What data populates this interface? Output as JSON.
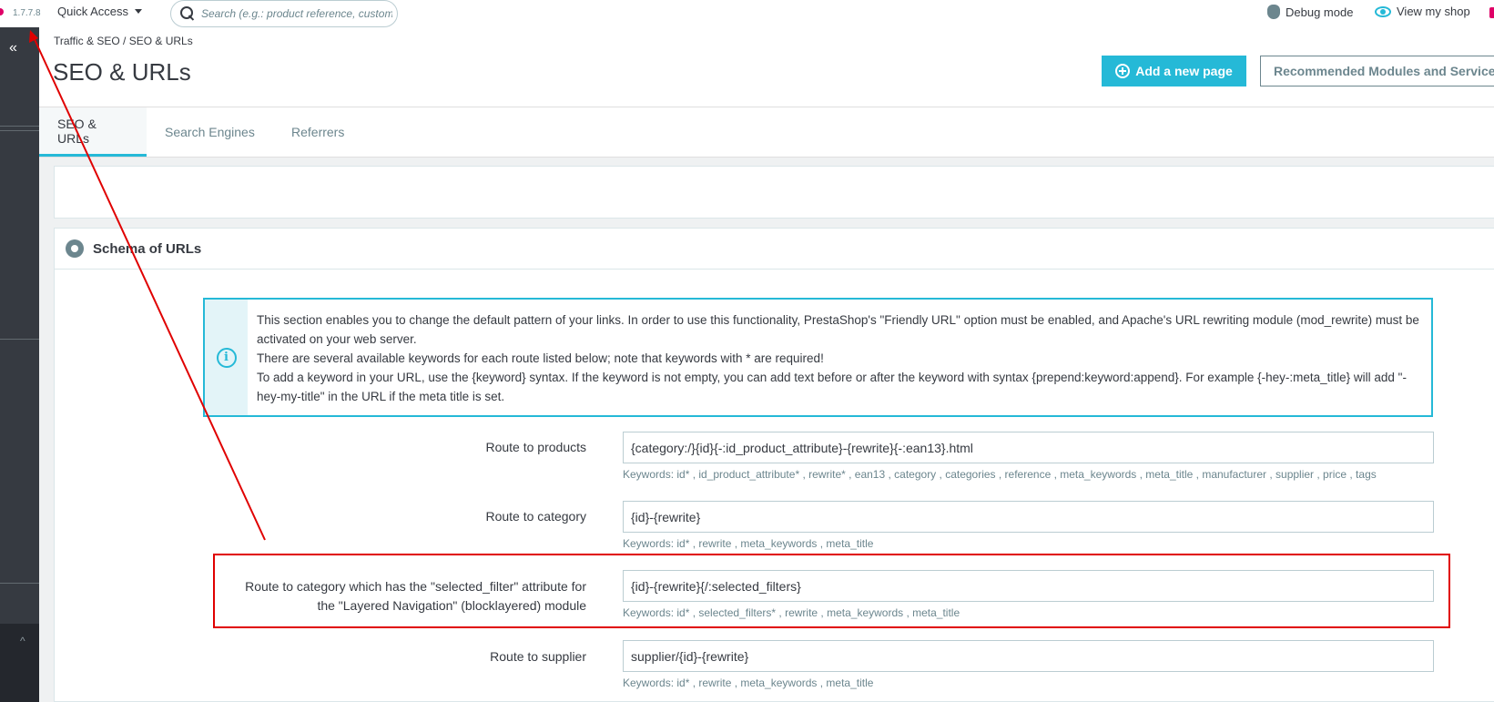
{
  "header": {
    "version": "1.7.7.8",
    "quick_access": "Quick Access",
    "search_placeholder": "Search (e.g.: product reference, custome",
    "debug_mode": "Debug mode",
    "view_shop": "View my shop"
  },
  "sidebar": {
    "collapse_glyph": "«",
    "scroll_up_glyph": "^"
  },
  "page": {
    "breadcrumb": "Traffic & SEO  /  SEO & URLs",
    "title": "SEO & URLs",
    "add_page_button": "Add a new page",
    "recommended_button": "Recommended Modules and Services"
  },
  "tabs": [
    {
      "label": "SEO & URLs",
      "active": true
    },
    {
      "label": "Search Engines",
      "active": false
    },
    {
      "label": "Referrers",
      "active": false
    }
  ],
  "schema_panel": {
    "title": "Schema of URLs",
    "info_glyph": "i",
    "alert_lines": [
      "This section enables you to change the default pattern of your links. In order to use this functionality, PrestaShop's \"Friendly URL\" option must be enabled, and Apache's URL rewriting module (mod_rewrite) must be activated on your web server.",
      "There are several available keywords for each route listed below; note that keywords with * are required!",
      "To add a keyword in your URL, use the {keyword} syntax. If the keyword is not empty, you can add text before or after the keyword with syntax {prepend:keyword:append}. For example {-hey-:meta_title} will add \"-hey-my-title\" in the URL if the meta title is set."
    ],
    "routes": [
      {
        "label": "Route to products",
        "value": "{category:/}{id}{-:id_product_attribute}-{rewrite}{-:ean13}.html",
        "keywords": "Keywords: id* , id_product_attribute* , rewrite* , ean13 , category , categories , reference , meta_keywords , meta_title , manufacturer , supplier , price , tags"
      },
      {
        "label": "Route to category",
        "value": "{id}-{rewrite}",
        "keywords": "Keywords: id* , rewrite , meta_keywords , meta_title"
      },
      {
        "label_line1": "Route to category which has the \"selected_filter\" attribute for",
        "label_line2": "the \"Layered Navigation\" (blocklayered) module",
        "value": "{id}-{rewrite}{/:selected_filters}",
        "keywords": "Keywords: id* , selected_filters* , rewrite , meta_keywords , meta_title"
      },
      {
        "label": "Route to supplier",
        "value": "supplier/{id}-{rewrite}",
        "keywords": "Keywords: id* , rewrite , meta_keywords , meta_title"
      }
    ]
  },
  "colors": {
    "accent": "#25b9d7",
    "sidebar": "#363a41",
    "annotation": "#e00000"
  }
}
